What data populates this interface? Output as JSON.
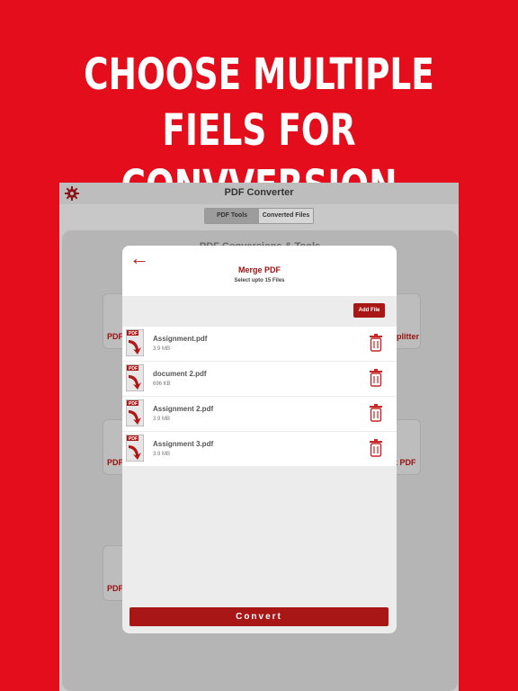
{
  "headline": {
    "line1": "CHOOSE MULTIPLE",
    "line2": "FIELS FOR CONVVERSION"
  },
  "app": {
    "title": "PDF Converter",
    "settings_icon": "gear-icon",
    "tabs": [
      {
        "label": "PDF Tools",
        "active": true
      },
      {
        "label": "Converted Files",
        "active": false
      }
    ],
    "panel_title": "PDF Conversions & Tools",
    "background_cards": [
      "PDF",
      "PDF",
      "PDF",
      "plitter",
      "k PDF"
    ]
  },
  "modal": {
    "back_icon": "back-arrow-icon",
    "title": "Merge PDF",
    "subtitle": "Select upto 15 Files",
    "add_file_label": "Add File",
    "files": [
      {
        "name": "Assignment.pdf",
        "size": "3.9 MB"
      },
      {
        "name": "document 2.pdf",
        "size": "696 KB"
      },
      {
        "name": "Assignment 2.pdf",
        "size": "3.9 MB"
      },
      {
        "name": "Assignment 3.pdf",
        "size": "3.9 MB"
      }
    ],
    "convert_label": "Convert"
  },
  "colors": {
    "background": "#e30d1b",
    "accent": "#a81616",
    "modal_bg": "#ececec"
  }
}
